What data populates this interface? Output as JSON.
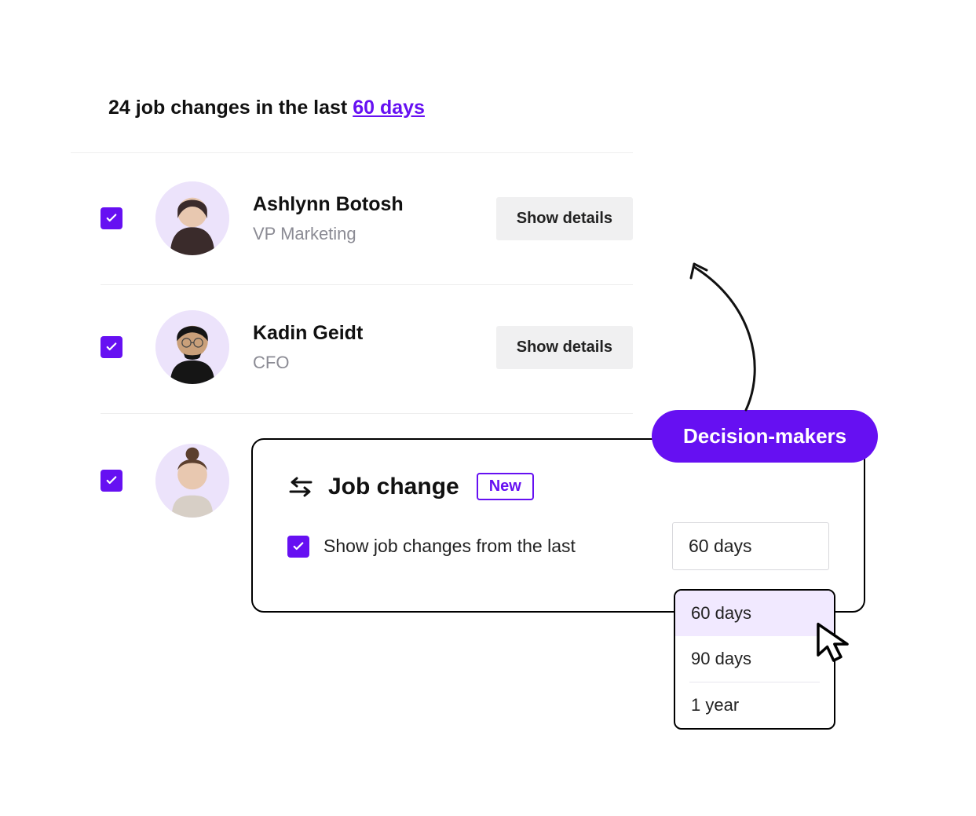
{
  "header": {
    "count": "24",
    "text1": "job changes in the last",
    "period": "60 days"
  },
  "people": [
    {
      "name": "Ashlynn Botosh",
      "title": "VP Marketing",
      "checked": true
    },
    {
      "name": "Kadin Geidt",
      "title": "CFO",
      "checked": true
    },
    {
      "name": "",
      "title": "",
      "checked": true
    }
  ],
  "buttons": {
    "show_details": "Show details"
  },
  "panel": {
    "title": "Job change",
    "badge": "New",
    "checkbox_label": "Show job changes from the last",
    "selected": "60 days"
  },
  "dropdown": {
    "options": [
      "60 days",
      "90 days",
      "1 year"
    ],
    "selected_index": 0
  },
  "pill": {
    "label": "Decision-makers"
  }
}
